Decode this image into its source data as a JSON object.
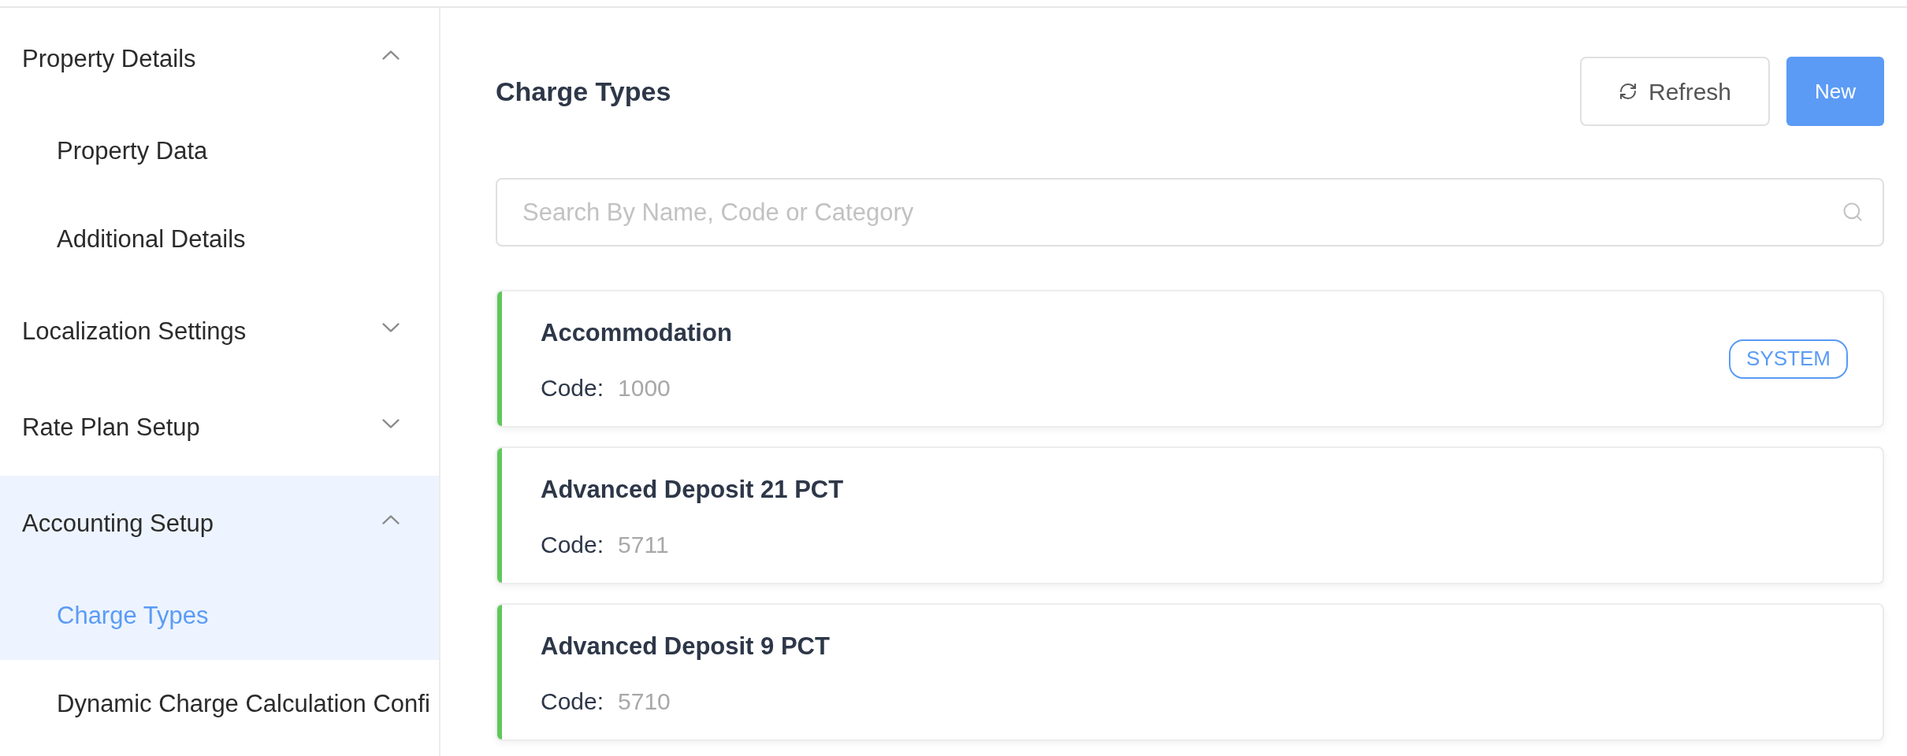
{
  "sidebar": {
    "items": [
      {
        "label": "Property Details",
        "selected": false,
        "expanded": true,
        "children": [
          {
            "label": "Property Data",
            "selected": false
          },
          {
            "label": "Additional Details",
            "selected": false
          }
        ]
      },
      {
        "label": "Localization Settings",
        "selected": false,
        "expanded": false
      },
      {
        "label": "Rate Plan Setup",
        "selected": false,
        "expanded": false
      },
      {
        "label": "Accounting Setup",
        "selected": true,
        "expanded": true,
        "children": [
          {
            "label": "Charge Types",
            "selected": true
          },
          {
            "label": "Dynamic Charge Calculation Confi",
            "selected": false
          }
        ]
      }
    ]
  },
  "header": {
    "title": "Charge Types",
    "buttons": [
      {
        "label": "Refresh",
        "kind": "secondary"
      },
      {
        "label": "New",
        "kind": "primary"
      }
    ]
  },
  "search": {
    "placeholder": "Search By Name, Code or Category"
  },
  "charge_types": [
    {
      "name": "Accommodation",
      "code_label": "Code:",
      "code": "1000",
      "badge": "SYSTEM",
      "color": "#5ec85c"
    },
    {
      "name": "Advanced Deposit 21 PCT",
      "code_label": "Code:",
      "code": "5711",
      "color": "#5ec85c"
    },
    {
      "name": "Advanced Deposit 9 PCT",
      "code_label": "Code:",
      "code": "5710",
      "color": "#5ec85c"
    }
  ]
}
